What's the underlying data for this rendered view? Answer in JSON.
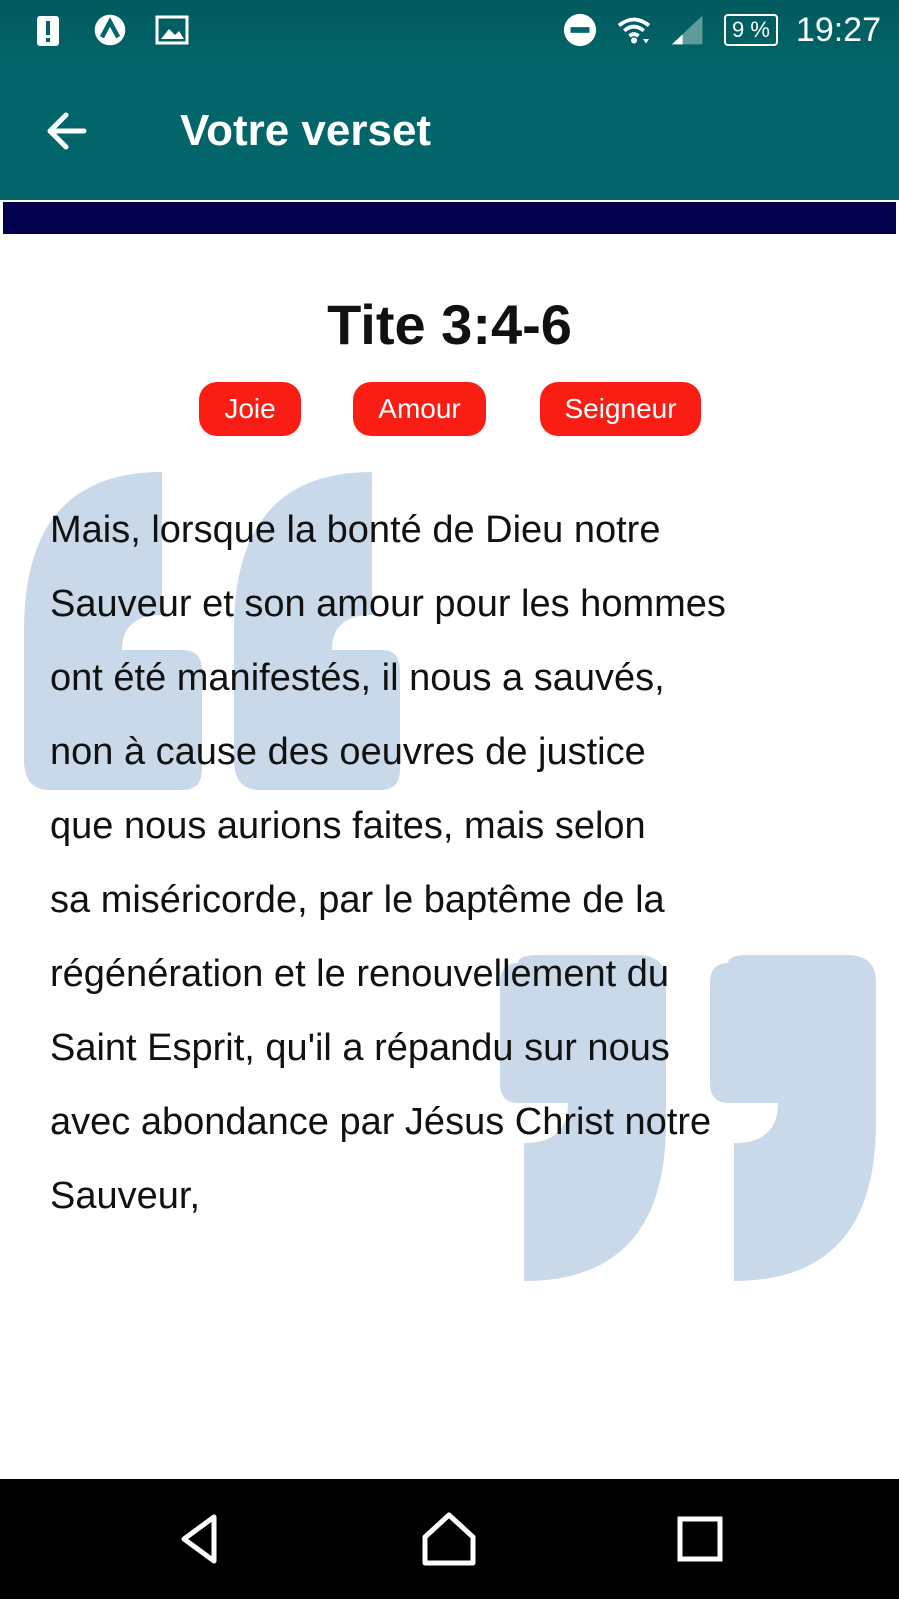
{
  "status_bar": {
    "left_icons": [
      "alert-icon",
      "launcher-icon",
      "image-icon"
    ],
    "right_icons": [
      "do-not-disturb-icon",
      "wifi-icon",
      "signal-icon"
    ],
    "battery": "9 %",
    "time": "19:27"
  },
  "app_bar": {
    "title": "Votre verset",
    "back_icon": "arrow-left-icon"
  },
  "verse": {
    "reference": "Tite 3:4-6",
    "tags": [
      "Joie",
      "Amour",
      "Seigneur"
    ],
    "lines": [
      "Mais, lorsque la bonté de Dieu notre",
      "Sauveur et son amour pour les hommes",
      "ont été manifestés, il nous a sauvés,",
      "non à cause des oeuvres de justice",
      "que nous aurions faites, mais selon",
      "sa miséricorde, par le baptême de la",
      "régénération et le renouvellement du",
      "Saint Esprit, qu'il a répandu sur nous",
      "avec abondance par Jésus Christ notre",
      "Sauveur,"
    ]
  },
  "nav_bar": {
    "buttons": [
      "back-triangle-icon",
      "home-icon",
      "recents-icon"
    ]
  },
  "colors": {
    "app_bar": "#016569",
    "accent_strip": "#03004d",
    "tag": "#fa1d13",
    "quote_marks": "#c9d9ea"
  }
}
